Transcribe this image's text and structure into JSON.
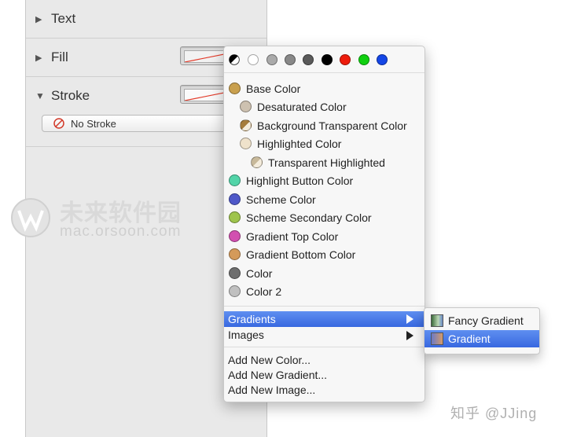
{
  "inspector": {
    "sections": [
      {
        "title": "Text",
        "expanded": false
      },
      {
        "title": "Fill",
        "expanded": false
      },
      {
        "title": "Stroke",
        "expanded": true
      }
    ],
    "no_stroke_label": "No Stroke"
  },
  "watermark": {
    "text": "未来软件园",
    "url": "mac.orsoon.com"
  },
  "color_menu": {
    "quick_colors": [
      "#ffffff",
      "#aaaaaa",
      "#888888",
      "#5a5a5a",
      "#000000",
      "#ee1c0c",
      "#10d010",
      "#1446e6"
    ],
    "items": [
      {
        "label": "Base Color",
        "color": "#c9a04e"
      },
      {
        "label": "Desaturated Color",
        "color": "#cdc1b0"
      },
      {
        "label": "Background Transparent Color",
        "color": "#a57c3c"
      },
      {
        "label": "Highlighted Color",
        "color": "#efe2cb"
      },
      {
        "label": "Transparent Highlighted",
        "color": "#c8b99a"
      },
      {
        "label": "Highlight Button Color",
        "color": "#52d4a8"
      },
      {
        "label": "Scheme Color",
        "color": "#4e58c8"
      },
      {
        "label": "Scheme Secondary Color",
        "color": "#9ec44c"
      },
      {
        "label": "Gradient Top Color",
        "color": "#d24fb0"
      },
      {
        "label": "Gradient Bottom Color",
        "color": "#d49a5a"
      },
      {
        "label": "Color",
        "color": "#6e6e6e"
      },
      {
        "label": "Color 2",
        "color": "#c0c0c0"
      }
    ],
    "gradients_label": "Gradients",
    "images_label": "Images",
    "add_color": "Add New Color...",
    "add_gradient": "Add New Gradient...",
    "add_image": "Add New Image..."
  },
  "gradient_submenu": {
    "items": [
      {
        "label": "Fancy Gradient",
        "selected": false
      },
      {
        "label": "Gradient",
        "selected": true
      }
    ]
  },
  "credit": "知乎 @JJing"
}
